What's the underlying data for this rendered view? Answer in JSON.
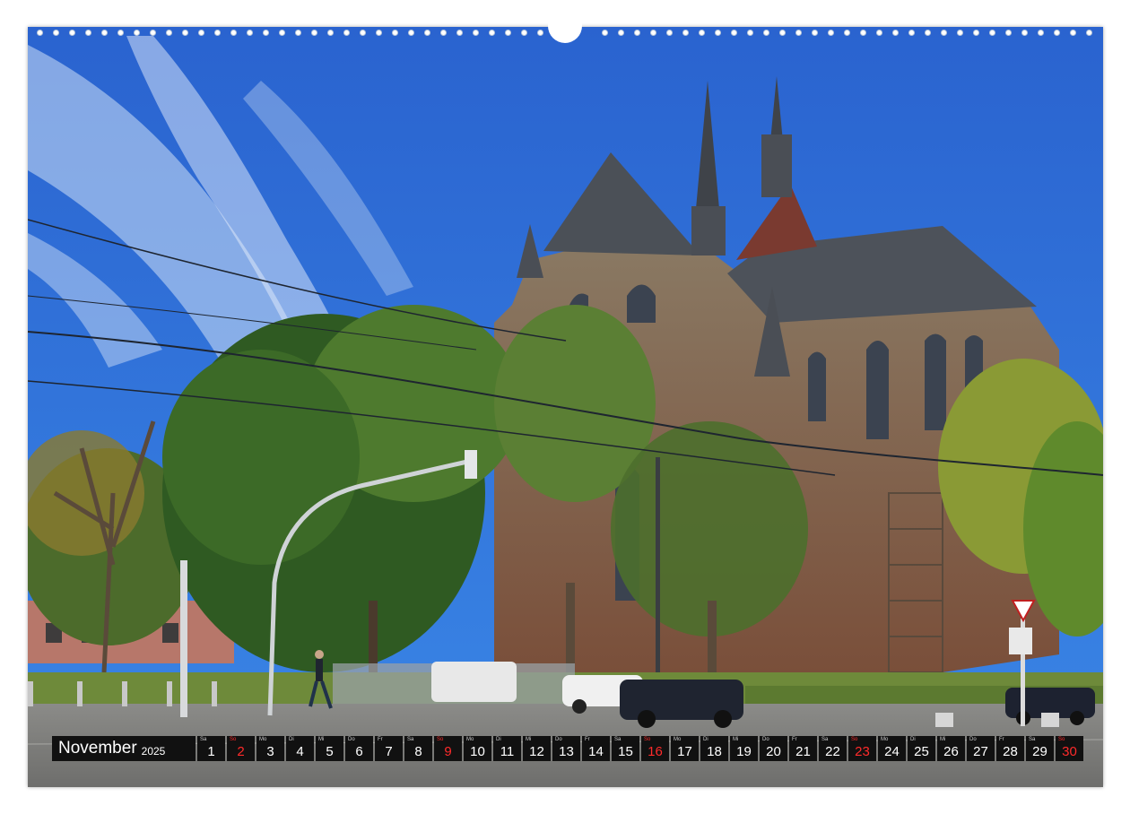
{
  "calendar": {
    "month": "November",
    "year": "2025",
    "days": [
      {
        "wd": "Sa",
        "d": "1",
        "sun": false
      },
      {
        "wd": "So",
        "d": "2",
        "sun": true
      },
      {
        "wd": "Mo",
        "d": "3",
        "sun": false
      },
      {
        "wd": "Di",
        "d": "4",
        "sun": false
      },
      {
        "wd": "Mi",
        "d": "5",
        "sun": false
      },
      {
        "wd": "Do",
        "d": "6",
        "sun": false
      },
      {
        "wd": "Fr",
        "d": "7",
        "sun": false
      },
      {
        "wd": "Sa",
        "d": "8",
        "sun": false
      },
      {
        "wd": "So",
        "d": "9",
        "sun": true
      },
      {
        "wd": "Mo",
        "d": "10",
        "sun": false
      },
      {
        "wd": "Di",
        "d": "11",
        "sun": false
      },
      {
        "wd": "Mi",
        "d": "12",
        "sun": false
      },
      {
        "wd": "Do",
        "d": "13",
        "sun": false
      },
      {
        "wd": "Fr",
        "d": "14",
        "sun": false
      },
      {
        "wd": "Sa",
        "d": "15",
        "sun": false
      },
      {
        "wd": "So",
        "d": "16",
        "sun": true
      },
      {
        "wd": "Mo",
        "d": "17",
        "sun": false
      },
      {
        "wd": "Di",
        "d": "18",
        "sun": false
      },
      {
        "wd": "Mi",
        "d": "19",
        "sun": false
      },
      {
        "wd": "Do",
        "d": "20",
        "sun": false
      },
      {
        "wd": "Fr",
        "d": "21",
        "sun": false
      },
      {
        "wd": "Sa",
        "d": "22",
        "sun": false
      },
      {
        "wd": "So",
        "d": "23",
        "sun": true
      },
      {
        "wd": "Mo",
        "d": "24",
        "sun": false
      },
      {
        "wd": "Di",
        "d": "25",
        "sun": false
      },
      {
        "wd": "Mi",
        "d": "26",
        "sun": false
      },
      {
        "wd": "Do",
        "d": "27",
        "sun": false
      },
      {
        "wd": "Fr",
        "d": "28",
        "sun": false
      },
      {
        "wd": "Sa",
        "d": "29",
        "sun": false
      },
      {
        "wd": "So",
        "d": "30",
        "sun": true
      }
    ]
  },
  "colors": {
    "sky": "#2f6fd6",
    "strip_bg": "#111111",
    "sunday": "#ff2b2b"
  }
}
